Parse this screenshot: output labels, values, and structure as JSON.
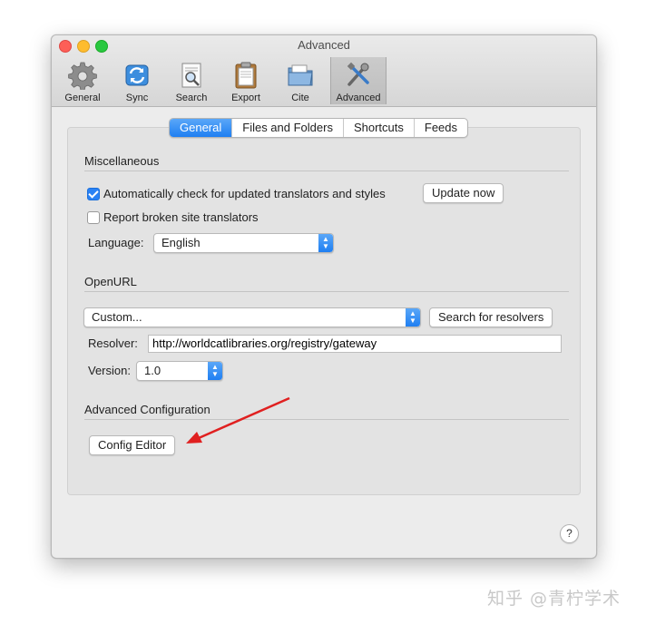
{
  "window": {
    "title": "Advanced"
  },
  "toolbar": {
    "items": [
      {
        "label": "General",
        "icon": "gear-icon"
      },
      {
        "label": "Sync",
        "icon": "sync-icon"
      },
      {
        "label": "Search",
        "icon": "search-document-icon"
      },
      {
        "label": "Export",
        "icon": "clipboard-icon"
      },
      {
        "label": "Cite",
        "icon": "folder-icon"
      },
      {
        "label": "Advanced",
        "icon": "tools-icon",
        "selected": true
      }
    ]
  },
  "tabs": [
    {
      "label": "General",
      "selected": true
    },
    {
      "label": "Files and Folders"
    },
    {
      "label": "Shortcuts"
    },
    {
      "label": "Feeds"
    }
  ],
  "miscellaneous": {
    "title": "Miscellaneous",
    "auto_check_label": "Automatically check for updated translators and styles",
    "auto_check_checked": true,
    "update_now_label": "Update now",
    "report_broken_label": "Report broken site translators",
    "report_broken_checked": false,
    "language_label": "Language:",
    "language_value": "English"
  },
  "openurl": {
    "title": "OpenURL",
    "resolver_select_value": "Custom...",
    "search_resolvers_label": "Search for resolvers",
    "resolver_label": "Resolver:",
    "resolver_value": "http://worldcatlibraries.org/registry/gateway",
    "version_label": "Version:",
    "version_value": "1.0"
  },
  "advanced_config": {
    "title": "Advanced Configuration",
    "config_editor_label": "Config Editor"
  },
  "help_label": "?",
  "watermark": "知乎 @青柠学术",
  "colors": {
    "accent": "#2a82f4",
    "annotation_arrow": "#e02020"
  }
}
